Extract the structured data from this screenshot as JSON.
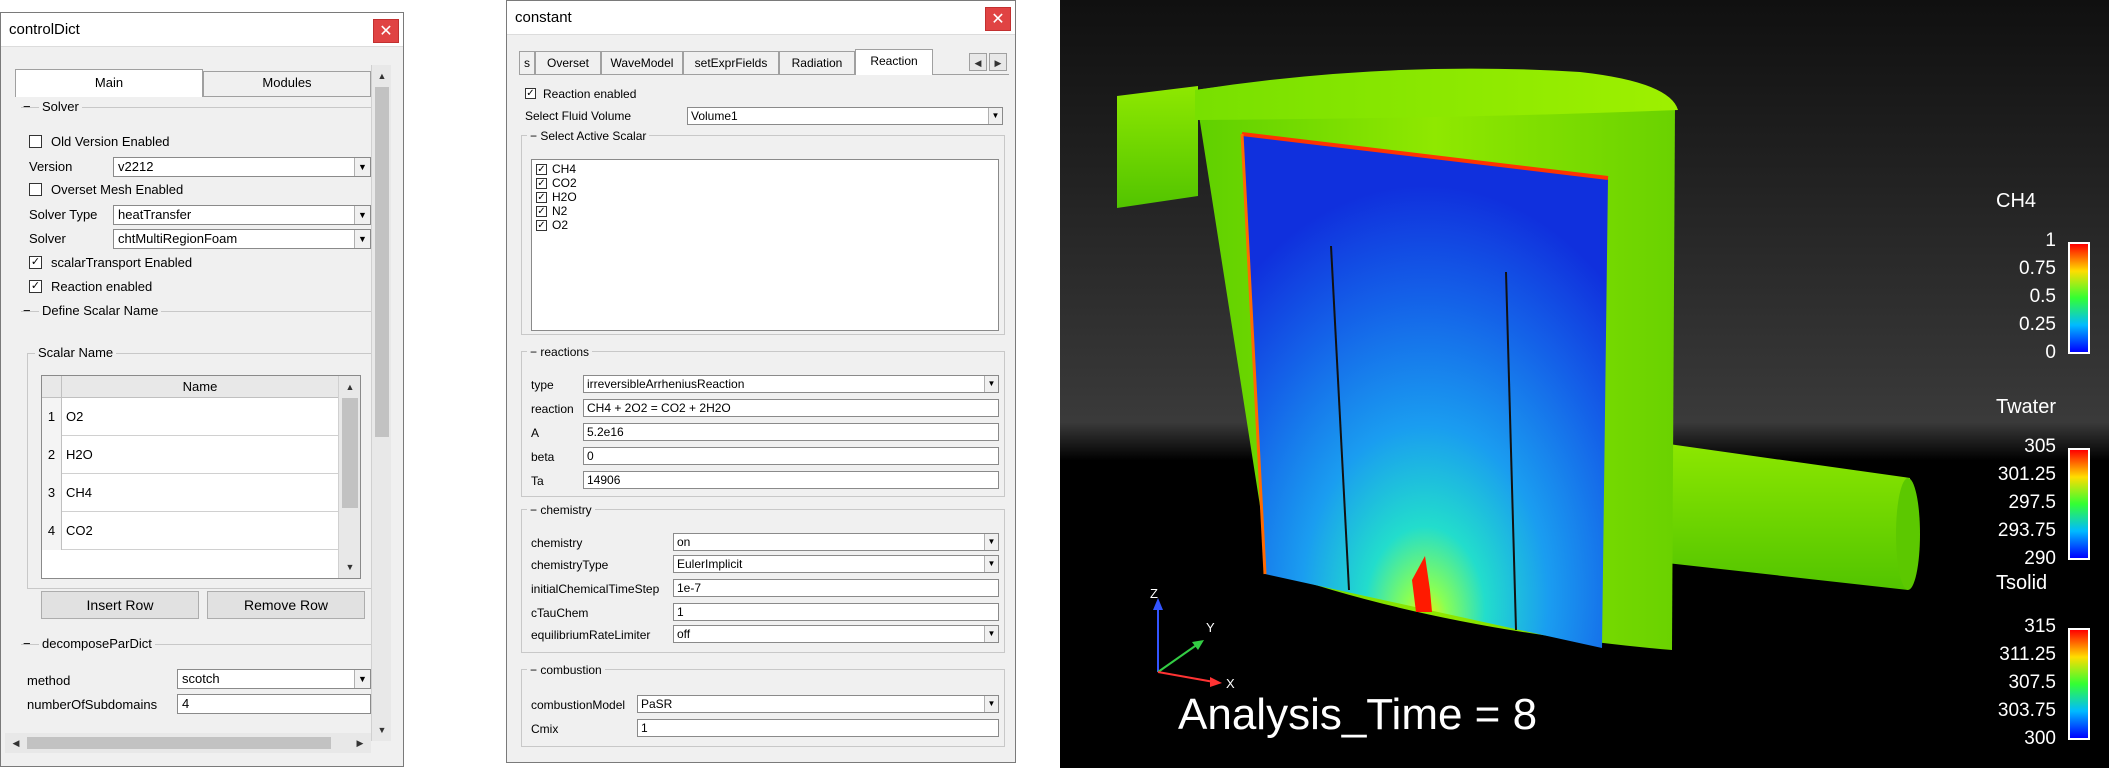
{
  "controlDict": {
    "title": "controlDict",
    "tabs": [
      "Main",
      "Modules"
    ],
    "solver_group": "Solver",
    "old_version_label": "Old Version Enabled",
    "version_label": "Version",
    "version_value": "v2212",
    "overset_label": "Overset Mesh Enabled",
    "solver_type_label": "Solver Type",
    "solver_type_value": "heatTransfer",
    "solver_label": "Solver",
    "solver_value": "chtMultiRegionFoam",
    "scalar_transport_label": "scalarTransport Enabled",
    "reaction_label": "Reaction enabled",
    "define_scalar_group": "Define Scalar Name",
    "scalar_name_group": "Scalar Name",
    "table_header": "Name",
    "rows": [
      {
        "idx": "1",
        "name": "O2"
      },
      {
        "idx": "2",
        "name": "H2O"
      },
      {
        "idx": "3",
        "name": "CH4"
      },
      {
        "idx": "4",
        "name": "CO2"
      }
    ],
    "insert_row": "Insert Row",
    "remove_row": "Remove Row",
    "decompose_group": "decomposeParDict",
    "method_label": "method",
    "method_value": "scotch",
    "subdomains_label": "numberOfSubdomains",
    "subdomains_value": "4"
  },
  "constant": {
    "title": "constant",
    "tabs": [
      "s",
      "Overset",
      "WaveModel",
      "setExprFields",
      "Radiation",
      "Reaction"
    ],
    "reaction_enabled_label": "Reaction enabled",
    "fluid_volume_label": "Select Fluid Volume",
    "fluid_volume_value": "Volume1",
    "active_scalar_group": "Select Active Scalar",
    "scalars": [
      "CH4",
      "CO2",
      "H2O",
      "N2",
      "O2"
    ],
    "reactions_group": "reactions",
    "type_label": "type",
    "type_value": "irreversibleArrheniusReaction",
    "reaction_label": "reaction",
    "reaction_value": "CH4 + 2O2 = CO2 + 2H2O",
    "A_label": "A",
    "A_value": "5.2e16",
    "beta_label": "beta",
    "beta_value": "0",
    "Ta_label": "Ta",
    "Ta_value": "14906",
    "chemistry_group": "chemistry",
    "chemistry_label": "chemistry",
    "chemistry_value": "on",
    "chemistryType_label": "chemistryType",
    "chemistryType_value": "EulerImplicit",
    "initialTimeStep_label": "initialChemicalTimeStep",
    "initialTimeStep_value": "1e-7",
    "cTauChem_label": "cTauChem",
    "cTauChem_value": "1",
    "equilibrium_label": "equilibriumRateLimiter",
    "equilibrium_value": "off",
    "combustion_group": "combustion",
    "combustionModel_label": "combustionModel",
    "combustionModel_value": "PaSR",
    "Cmix_label": "Cmix",
    "Cmix_value": "1"
  },
  "viewer": {
    "analysis_time": "Analysis_Time = 8",
    "axes": {
      "z": "Z",
      "y": "Y",
      "x": "X"
    },
    "legends": [
      {
        "title": "CH4",
        "ticks": [
          "1",
          "0.75",
          "0.5",
          "0.25",
          "0"
        ]
      },
      {
        "title": "Twater",
        "ticks": [
          "305",
          "301.25",
          "297.5",
          "293.75",
          "290"
        ]
      },
      {
        "title": "Tsolid",
        "ticks": [
          "315",
          "311.25",
          "307.5",
          "303.75",
          "300"
        ]
      }
    ]
  }
}
